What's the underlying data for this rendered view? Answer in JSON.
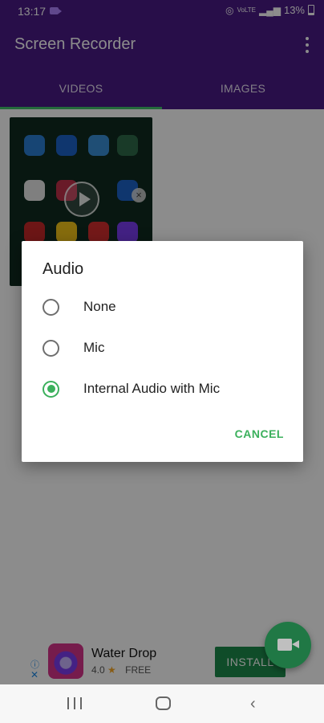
{
  "status_bar": {
    "time": "13:17",
    "network": "VoLTE",
    "battery": "13%"
  },
  "app_bar": {
    "title": "Screen Recorder",
    "tabs": [
      {
        "label": "VIDEOS",
        "active": true
      },
      {
        "label": "IMAGES",
        "active": false
      }
    ]
  },
  "dialog": {
    "title": "Audio",
    "options": [
      {
        "label": "None",
        "checked": false
      },
      {
        "label": "Mic",
        "checked": false
      },
      {
        "label": "Internal Audio with Mic",
        "checked": true
      }
    ],
    "cancel_label": "CANCEL"
  },
  "ad": {
    "info_icon": "ⓘ",
    "close_icon": "✕",
    "title": "Water Drop",
    "rating": "4.0",
    "price": "FREE",
    "install_label": "INSTALL"
  },
  "colors": {
    "app_bar": "#4a1a86",
    "accent": "#3bb05c",
    "fab": "#2aa05c",
    "install_button": "#1b8a4a"
  }
}
